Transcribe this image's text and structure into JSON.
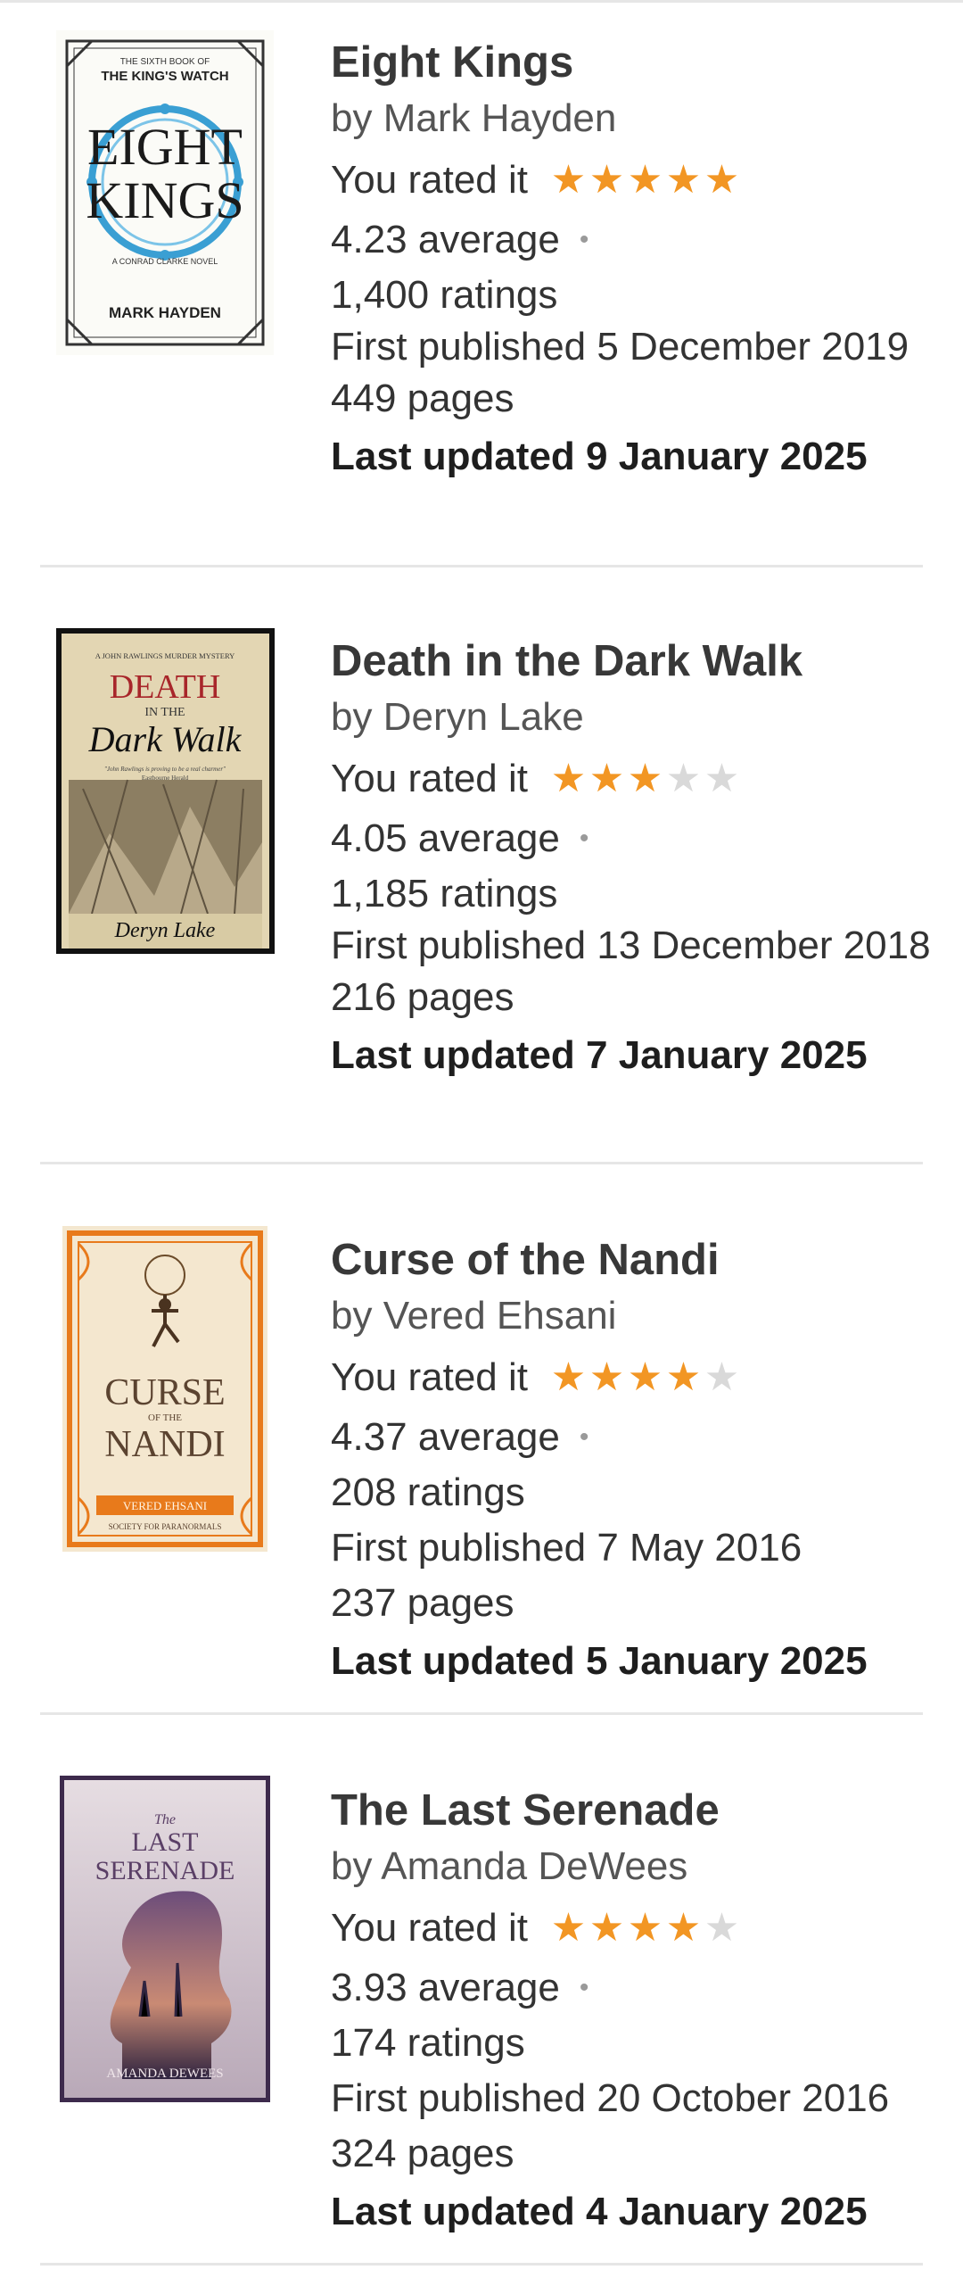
{
  "books": [
    {
      "title": "Eight Kings",
      "author": "by Mark Hayden",
      "rated_label": "You rated it",
      "rating": 5,
      "average": "4.23 average",
      "ratings_count": "1,400 ratings",
      "first_published": "First published 5 December 2019",
      "pages": "449 pages",
      "last_updated": "Last updated 9 January 2025",
      "cover": {
        "top_line": "THE SIXTH BOOK OF",
        "series": "THE KING'S WATCH",
        "title_1": "EIGHT",
        "title_2": "KINGS",
        "subtitle": "A CONRAD CLARKE NOVEL",
        "author": "MARK HAYDEN",
        "bg": "#fbfbf7",
        "accent": "#3a9fd3"
      }
    },
    {
      "title": "Death in the Dark Walk",
      "author": "by Deryn Lake",
      "rated_label": "You rated it",
      "rating": 3,
      "average": "4.05 average",
      "ratings_count": "1,185 ratings",
      "first_published": "First published 13 December 2018",
      "pages": "216 pages",
      "last_updated": "Last updated 7 January 2025",
      "cover": {
        "top_line": "A JOHN RAWLINGS MURDER MYSTERY",
        "title_1": "DEATH",
        "title_mid": "IN THE",
        "title_2": "Dark Walk",
        "quote": "\"John Rawlings is proving to be a real charmer\"",
        "quote_src": "Eastbourne Herald",
        "author": "Deryn Lake",
        "bg": "#e3d6b3",
        "accent": "#a8262a"
      }
    },
    {
      "title": "Curse of the Nandi",
      "author": "by Vered Ehsani",
      "rated_label": "You rated it",
      "rating": 4,
      "average": "4.37 average",
      "ratings_count": "208 ratings",
      "first_published": "First published 7 May 2016",
      "pages": "237 pages",
      "last_updated": "Last updated 5 January 2025",
      "cover": {
        "title_1": "CURSE",
        "title_mid": "OF THE",
        "title_2": "NANDI",
        "author": "VERED EHSANI",
        "series": "SOCIETY FOR PARANORMALS",
        "bg": "#f4e7cf",
        "accent": "#e87a1b"
      }
    },
    {
      "title": "The Last Serenade",
      "author": "by Amanda DeWees",
      "rated_label": "You rated it",
      "rating": 4,
      "average": "3.93 average",
      "ratings_count": "174 ratings",
      "first_published": "First published 20 October 2016",
      "pages": "324 pages",
      "last_updated": "Last updated 4 January 2025",
      "cover": {
        "title_small": "The",
        "title_1": "LAST",
        "title_2": "SERENADE",
        "author": "AMANDA DEWEES",
        "bg": "#d9cdd6",
        "accent": "#5a3f66"
      }
    }
  ],
  "icons": {
    "star": "star-icon",
    "dot": "dot-icon"
  },
  "colors": {
    "star_on": "#f29624",
    "star_off": "#d9d9d9",
    "separator": "#e6e6e6"
  }
}
